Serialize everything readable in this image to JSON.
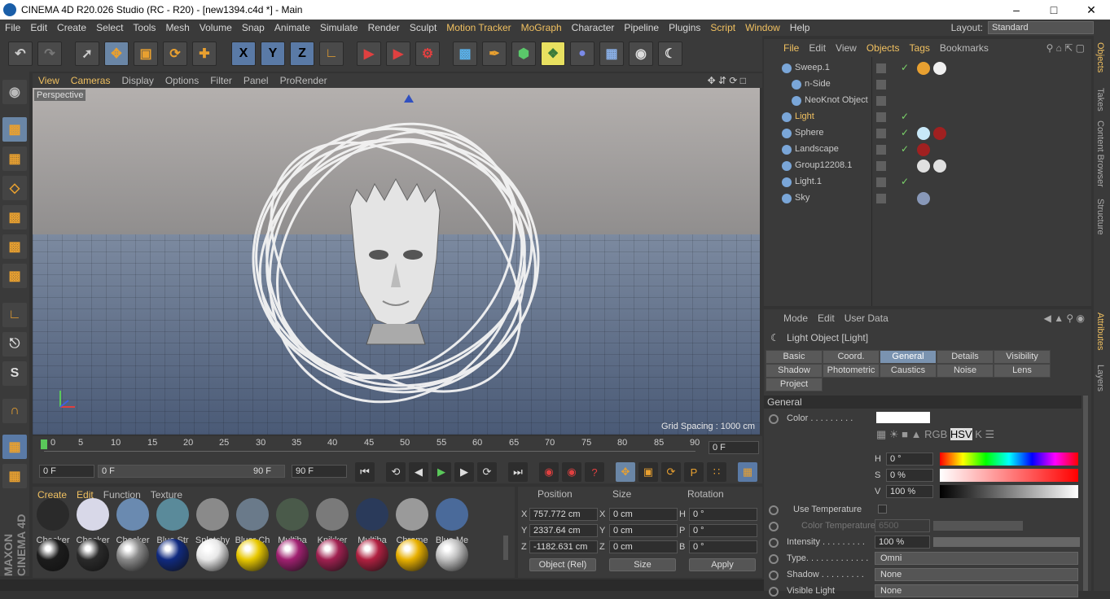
{
  "window": {
    "title": "CINEMA 4D R20.026 Studio (RC - R20) - [new1394.c4d *] - Main"
  },
  "menu": [
    "File",
    "Edit",
    "Create",
    "Select",
    "Tools",
    "Mesh",
    "Volume",
    "Snap",
    "Animate",
    "Simulate",
    "Render",
    "Sculpt",
    "Motion Tracker",
    "MoGraph",
    "Character",
    "Pipeline",
    "Plugins",
    "Script",
    "Window",
    "Help"
  ],
  "layout": {
    "label": "Layout:",
    "value": "Standard"
  },
  "toolbar": {
    "x": "X",
    "y": "Y",
    "z": "Z"
  },
  "viewport": {
    "menu": [
      "View",
      "Cameras",
      "Display",
      "Options",
      "Filter",
      "Panel",
      "ProRender"
    ],
    "label": "Perspective",
    "grid_spacing": "Grid Spacing : 1000 cm"
  },
  "timeline": {
    "ticks": [
      "0",
      "5",
      "10",
      "15",
      "20",
      "25",
      "30",
      "35",
      "40",
      "45",
      "50",
      "55",
      "60",
      "65",
      "70",
      "75",
      "80",
      "85",
      "90"
    ],
    "current_frame": "0 F"
  },
  "playback": {
    "start": "0 F",
    "slider_start": "0 F",
    "slider_end": "90 F",
    "end": "90 F"
  },
  "material_manager": {
    "menu": [
      "Create",
      "Edit",
      "Function",
      "Texture"
    ],
    "row1": [
      "Checker",
      "Checker",
      "Checker",
      "Blue Str",
      "Splotchy",
      "Bluer Ch",
      "Multiba",
      "Knikker",
      "Multiba",
      "Chrome",
      "Blue Me"
    ],
    "row2_colors": [
      "#1c1c1c",
      "#2a2a2a",
      "#8a8a8a",
      "#102a80",
      "#e8e8e8",
      "#e8c800",
      "#a02070",
      "#a02050",
      "#b02040",
      "#e8b000",
      "#c0c0c0"
    ]
  },
  "coordinates": {
    "headers": [
      "Position",
      "Size",
      "Rotation"
    ],
    "rows": [
      {
        "a": "X",
        "pos": "757.772 cm",
        "b": "X",
        "size": "0 cm",
        "c": "H",
        "rot": "0 °"
      },
      {
        "a": "Y",
        "pos": "2337.64 cm",
        "b": "Y",
        "size": "0 cm",
        "c": "P",
        "rot": "0 °"
      },
      {
        "a": "Z",
        "pos": "-1182.631 cm",
        "b": "Z",
        "size": "0 cm",
        "c": "B",
        "rot": "0 °"
      }
    ],
    "mode": "Object (Rel)",
    "size_mode": "Size",
    "apply": "Apply"
  },
  "object_manager": {
    "menu": [
      "File",
      "Edit",
      "View",
      "Objects",
      "Tags",
      "Bookmarks"
    ],
    "objects": [
      {
        "name": "Sweep.1",
        "indent": 0,
        "check": "✓",
        "highlight": false
      },
      {
        "name": "n-Side",
        "indent": 1,
        "check": "",
        "highlight": false
      },
      {
        "name": "NeoKnot Object",
        "indent": 1,
        "check": "",
        "highlight": false
      },
      {
        "name": "Light",
        "indent": 0,
        "check": "✓",
        "highlight": true
      },
      {
        "name": "Sphere",
        "indent": 0,
        "check": "✓",
        "highlight": false
      },
      {
        "name": "Landscape",
        "indent": 0,
        "check": "✓",
        "highlight": false
      },
      {
        "name": "Group12208.1",
        "indent": 0,
        "check": "",
        "highlight": false
      },
      {
        "name": "Light.1",
        "indent": 0,
        "check": "✓",
        "highlight": false
      },
      {
        "name": "Sky",
        "indent": 0,
        "check": "",
        "highlight": false
      }
    ]
  },
  "attribute_manager": {
    "menu": [
      "Mode",
      "Edit",
      "User Data"
    ],
    "title": "Light Object [Light]",
    "tabs_row1": [
      "Basic",
      "Coord.",
      "General",
      "Details",
      "Visibility"
    ],
    "tabs_row2": [
      "Shadow",
      "Photometric",
      "Caustics",
      "Noise",
      "Lens"
    ],
    "tabs_row3": [
      "Project"
    ],
    "active_tab": "General",
    "section": "General",
    "color_label": "Color . . . . . . . . .",
    "hsv": [
      {
        "k": "H",
        "v": "0 °"
      },
      {
        "k": "S",
        "v": "0 %"
      },
      {
        "k": "V",
        "v": "100 %"
      }
    ],
    "use_temperature": "Use Temperature",
    "color_temperature": {
      "label": "Color Temperature",
      "value": "6500"
    },
    "intensity": {
      "label": "Intensity . . . . . . . . .",
      "value": "100 %"
    },
    "type": {
      "label": "Type. . . . . . . . . . . . .",
      "value": "Omni"
    },
    "shadow": {
      "label": "Shadow . . . . . . . . .",
      "value": "None"
    },
    "visible_light": {
      "label": "Visible Light",
      "value": "None"
    }
  },
  "right_tabs": [
    "Objects",
    "Takes",
    "Content Browser",
    "Structure",
    "Attributes",
    "Layers"
  ]
}
